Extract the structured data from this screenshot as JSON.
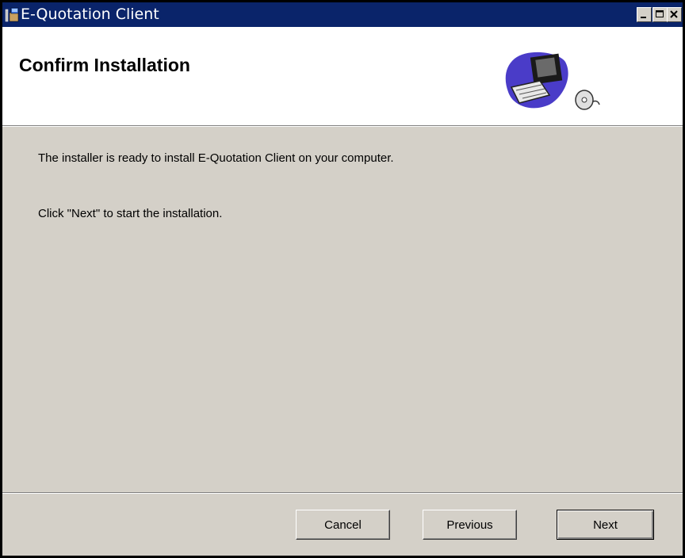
{
  "window": {
    "title": "E-Quotation Client",
    "icon": "installer-icon",
    "controls": {
      "minimize": "minimize-icon",
      "maximize": "maximize-icon",
      "close": "close-icon"
    }
  },
  "header": {
    "title": "Confirm Installation",
    "art": "computer-cd-icon"
  },
  "body": {
    "line1": "The installer is ready to install E-Quotation Client on your computer.",
    "line2": "Click \"Next\" to start the installation."
  },
  "buttons": {
    "cancel": "Cancel",
    "previous": "Previous",
    "next": "Next"
  },
  "colors": {
    "titlebar": "#0a246a",
    "dialog_face": "#d4d0c8",
    "header_bg": "#ffffff"
  }
}
